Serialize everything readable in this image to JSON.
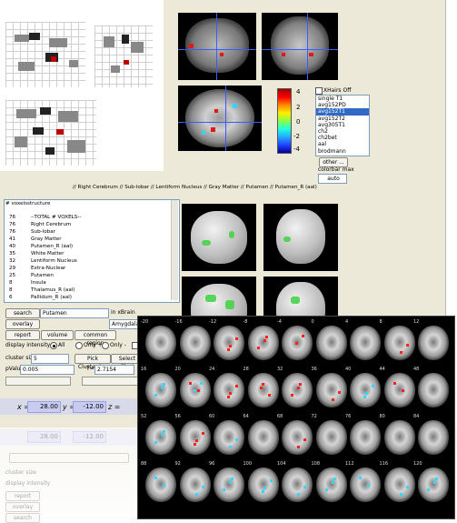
{
  "xhairs_off": "XHairs Off",
  "colorbar_ticks": [
    "4",
    "2",
    "0",
    "-2",
    "-4"
  ],
  "template_list": [
    "single T1",
    "avg152PD",
    "avg152T1",
    "avg152T2",
    "avg305T1",
    "ch2",
    "ch2bet",
    "aal",
    "brodmann"
  ],
  "template_selected": 2,
  "other_button": "other ...",
  "colorbar_max_label": "colorbar max",
  "colorbar_max_value": "auto",
  "atlas_path": "// Right Cerebrum // Sub-lobar // Lentiform Nucleus // Gray Matter // Putamen // Putamen_R (aal)",
  "table": {
    "headers": [
      "# voxels",
      "structure"
    ],
    "rows": [
      [
        "76",
        "--TOTAL # VOXELS--"
      ],
      [
        "76",
        "Right Cerebrum"
      ],
      [
        "76",
        "Sub-lobar"
      ],
      [
        "41",
        "Gray Matter"
      ],
      [
        "40",
        "Putamen_R (aal)"
      ],
      [
        "35",
        "White Matter"
      ],
      [
        "32",
        "Lentiform Nucleus"
      ],
      [
        "29",
        "Extra-Nuclear"
      ],
      [
        "25",
        "Putamen"
      ],
      [
        "8",
        "Insula"
      ],
      [
        "8",
        "Thalamus_R (aal)"
      ],
      [
        "6",
        "Pallidum_R (aal)"
      ]
    ]
  },
  "controls": {
    "search_button": "search",
    "search_value": "Putamen",
    "search_scope": "in xBrain",
    "overlay_button": "overlay",
    "overlay_value": "Amygdala",
    "report_button": "report",
    "volume_button": "volume",
    "common_region_button": "common region",
    "display_intensity_label": "display intensity",
    "radio_all": "All",
    "radio_only_plus": "Only +",
    "radio_only_minus": "Only -",
    "cluster_size_label": "cluster size",
    "cluster_size_value": "5",
    "pick_cluster_button": "Pick Cluster#...",
    "select_cluster_button": "Select Clust",
    "pvalue_label": "pValue=",
    "pvalue_value": "0.005",
    "t_label": "T=",
    "t_value": "2.7154"
  },
  "coords": {
    "x_label": "x =",
    "x_value": "28.00",
    "y_label": "y =",
    "y_value": "-12.00",
    "z_label": "z ="
  },
  "reflection": {
    "x_value": "28.00",
    "y_value": "-12.00",
    "cluster_size_label": "cluster size",
    "display_intensity_label": "display intensity",
    "report_button": "report",
    "overlay_button": "overlay",
    "search_button": "search"
  },
  "montage_labels": [
    "-20",
    "-16",
    "-12",
    "-8",
    "-4",
    "0",
    "4",
    "8",
    "12",
    "16",
    "20",
    "24",
    "28",
    "32",
    "36",
    "40",
    "44",
    "48",
    "52",
    "56",
    "60",
    "64",
    "68",
    "72",
    "76",
    "80",
    "84",
    "88",
    "92",
    "96",
    "100",
    "104",
    "108",
    "112",
    "116",
    "120"
  ]
}
